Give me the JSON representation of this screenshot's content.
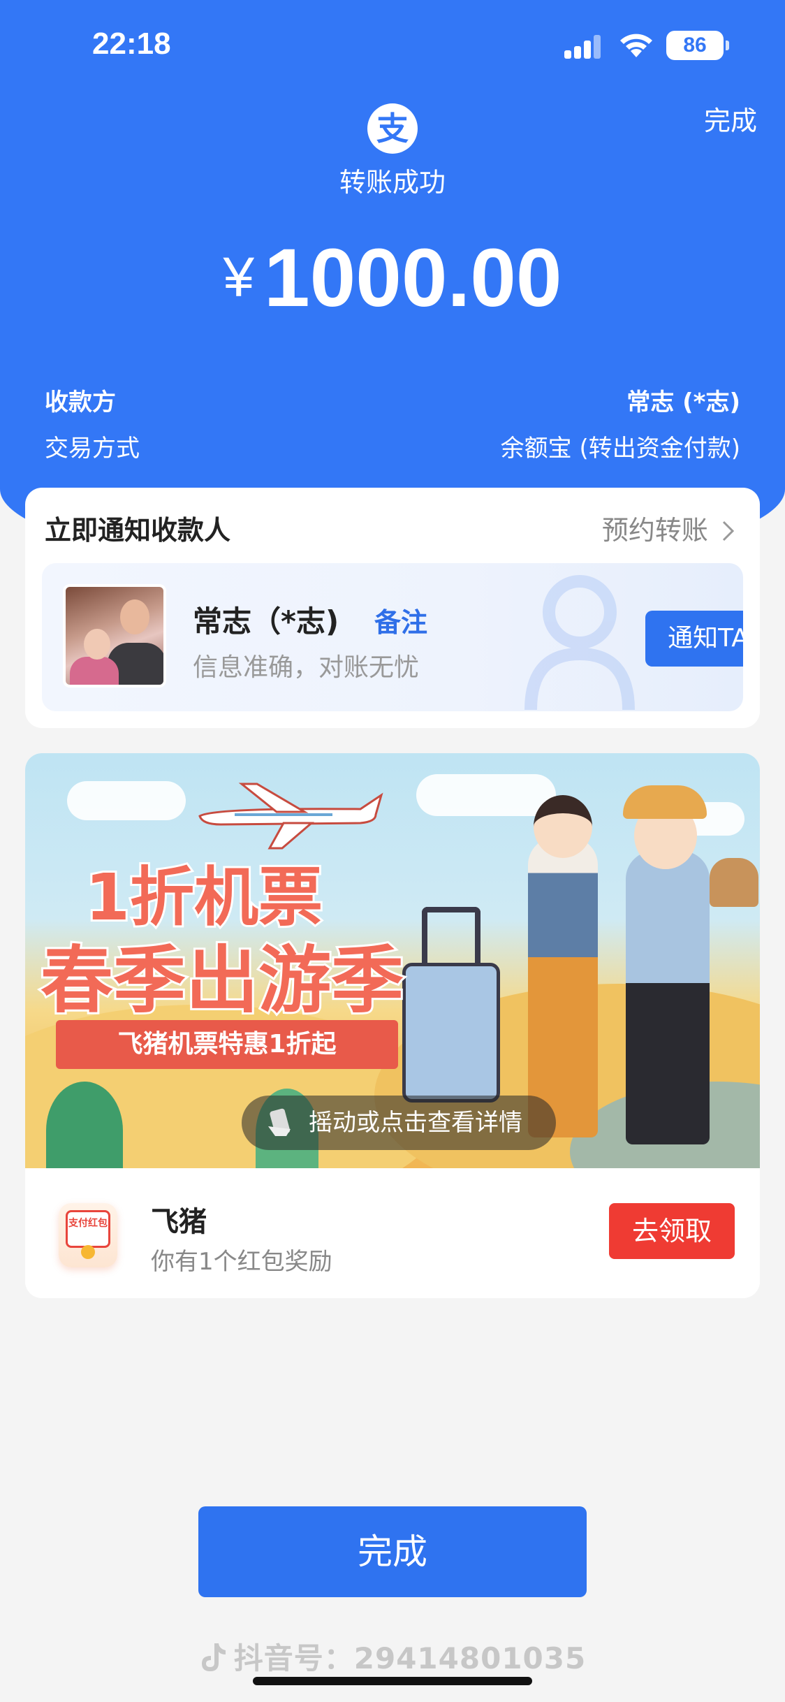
{
  "status_bar": {
    "time": "22:18",
    "battery": "86"
  },
  "header": {
    "done_label": "完成",
    "logo_glyph": "支",
    "status": "转账成功",
    "currency": "¥",
    "amount": "1000.00"
  },
  "details": {
    "payee_label": "收款方",
    "payee_value": "常志 (*志)",
    "method_label": "交易方式",
    "method_value": "余额宝 (转出资金付款)"
  },
  "notify": {
    "title": "立即通知收款人",
    "schedule_label": "预约转账",
    "person_name": "常志（*志)",
    "remark_label": "备注",
    "subtitle": "信息准确，对账无忧",
    "button_label": "通知TA"
  },
  "ad": {
    "headline_line1": "1折机票",
    "headline_line2": "春季出游季",
    "promo_strip": "飞猪机票特惠1折起",
    "shake_hint": "摇动或点击查看详情",
    "brand_icon_text": "支付红包",
    "brand_name": "飞猪",
    "reward_text": "你有1个红包奖励",
    "claim_label": "去领取"
  },
  "footer": {
    "done_label": "完成",
    "watermark": "抖音号：29414801035"
  },
  "colors": {
    "primary_blue": "#3377f6",
    "button_blue": "#2f73f0",
    "claim_red": "#ef3b33",
    "background": "#f4f4f4"
  },
  "icons": [
    "signal-icon",
    "wifi-icon",
    "battery-icon",
    "alipay-logo-icon",
    "chevron-right-icon",
    "shake-phone-icon",
    "douyin-icon"
  ]
}
